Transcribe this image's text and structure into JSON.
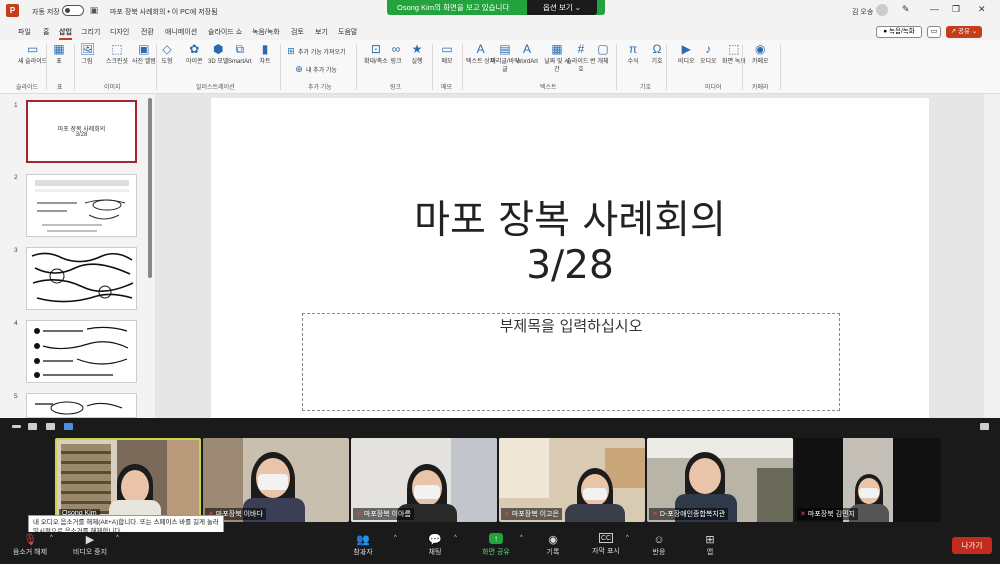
{
  "ppt": {
    "autosave_label": "자동 저장",
    "doc_title": "마포 장북  사례회의 • 이 PC에 저장됨",
    "user_name": "김 오송",
    "tabs": [
      "파일",
      "홈",
      "삽입",
      "그리기",
      "디자인",
      "전환",
      "애니메이션",
      "슬라이드 쇼",
      "녹음/녹화",
      "검토",
      "보기",
      "도움말"
    ],
    "active_tab": "삽입",
    "record_btn": "● 녹음/녹화",
    "share_btn": "↗ 공유 ⌄",
    "ribbon_items": [
      {
        "label": "새 슬라이드",
        "icon": "▭"
      },
      {
        "label": "표",
        "icon": "▦"
      },
      {
        "label": "그림",
        "icon": "🖼"
      },
      {
        "label": "스크린샷",
        "icon": "⬚"
      },
      {
        "label": "사진 앨범",
        "icon": "▣"
      },
      {
        "label": "도형",
        "icon": "◇"
      },
      {
        "label": "아이콘",
        "icon": "✿"
      },
      {
        "label": "3D 모델",
        "icon": "⬢"
      },
      {
        "label": "SmartArt",
        "icon": "⧉"
      },
      {
        "label": "차트",
        "icon": "▮"
      },
      {
        "label": "추가 기능 가져오기",
        "icon": "⊞"
      },
      {
        "label": "내 추가 기능",
        "icon": "⊕"
      },
      {
        "label": "확대/축소",
        "icon": "⊡"
      },
      {
        "label": "링크",
        "icon": "∞"
      },
      {
        "label": "실행",
        "icon": "★"
      },
      {
        "label": "메모",
        "icon": "▭"
      },
      {
        "label": "텍스트 상자",
        "icon": "A"
      },
      {
        "label": "머리글/바닥글",
        "icon": "▤"
      },
      {
        "label": "WordArt",
        "icon": "A"
      },
      {
        "label": "날짜 및 시간",
        "icon": "▦"
      },
      {
        "label": "슬라이드 번호",
        "icon": "#"
      },
      {
        "label": "개체",
        "icon": "▢"
      },
      {
        "label": "수식",
        "icon": "π"
      },
      {
        "label": "기호",
        "icon": "Ω"
      },
      {
        "label": "비디오",
        "icon": "▶"
      },
      {
        "label": "오디오",
        "icon": "♪"
      },
      {
        "label": "화면 녹화",
        "icon": "⬚"
      },
      {
        "label": "카메오",
        "icon": "◉"
      }
    ],
    "ribbon_groups": [
      "슬라이드",
      "표",
      "이미지",
      "일러스트레이션",
      "추가 기능",
      "링크",
      "메모",
      "텍스트",
      "기호",
      "미디어",
      "카메라"
    ],
    "slide_numbers": [
      "1",
      "2",
      "3",
      "4",
      "5"
    ],
    "thumb1_line1": "마포 장복 사례회의",
    "thumb1_line2": "3/28",
    "slide_title_line1": "마포 장복  사례회의",
    "slide_title_line2": "3/28",
    "subtitle_placeholder": "부제목을 입력하십시오"
  },
  "zoom": {
    "share_message": "Osong Kim의 화면을 보고 있습니다",
    "view_options": "옵션 보기  ⌄",
    "participants": [
      {
        "name": "Osong Kim",
        "muted": false
      },
      {
        "name": "마포장북 이바다",
        "muted": true
      },
      {
        "name": "마포장복 이아름",
        "muted": true
      },
      {
        "name": "마포장복 이고은",
        "muted": true
      },
      {
        "name": "D-포장애인종합복지관",
        "muted": true
      },
      {
        "name": "마포장북 김민지",
        "muted": true
      }
    ],
    "tooltip": "내 오디오 음소거를 해제(Alt+A)합니다. 또는 스페이스 바를 길게 눌러 일시적으로 음소거를 해제합니다.",
    "controls": {
      "unmute": "음소거 해제",
      "video": "비디오 중지",
      "participants": "참가자",
      "participants_count": "6",
      "chat": "채팅",
      "share": "화면 공유",
      "record": "기록",
      "captions": "자막 표시",
      "reactions": "반응",
      "apps": "앱",
      "leave": "나가기"
    }
  }
}
